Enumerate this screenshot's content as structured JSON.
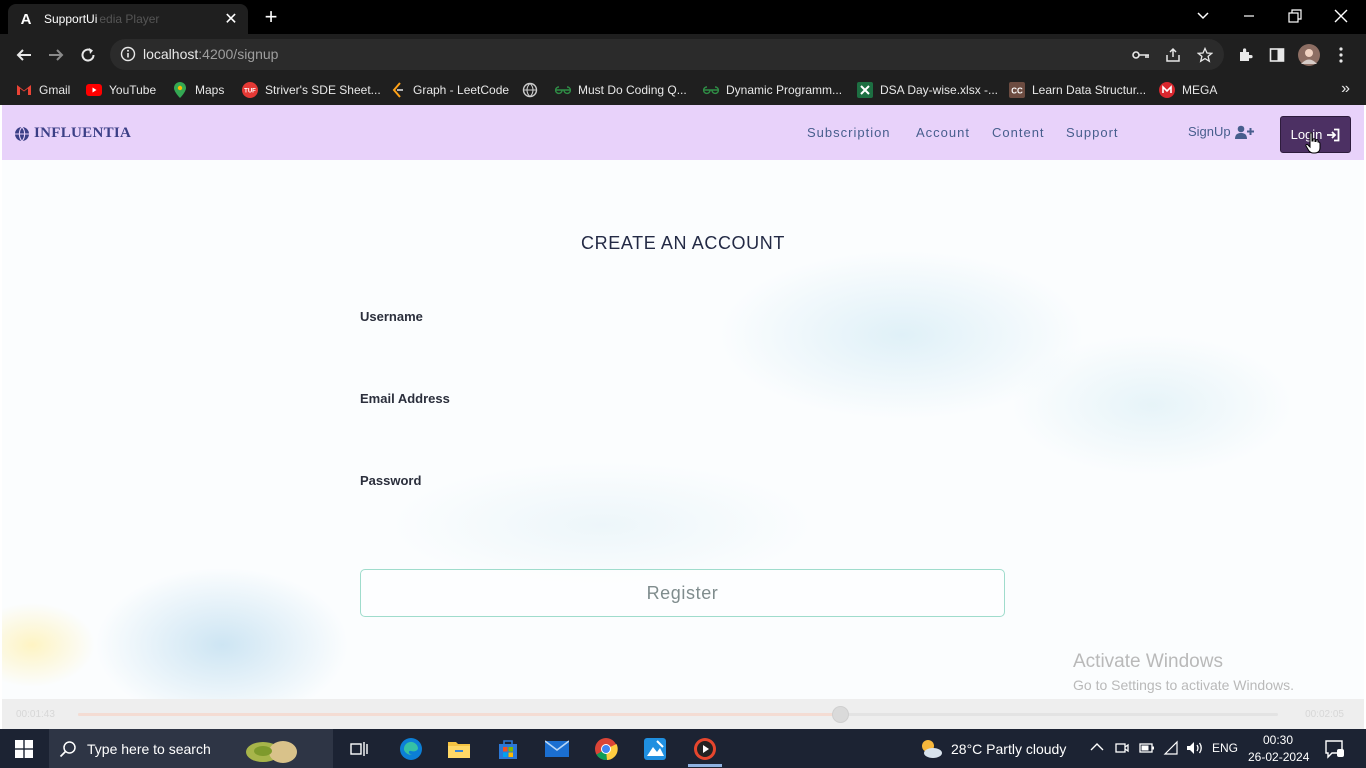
{
  "browser": {
    "tab": {
      "title": "SupportUi",
      "ghost_title": "edia Player",
      "favicon": "A"
    },
    "url": {
      "host": "localhost",
      "path": ":4200/signup"
    }
  },
  "bookmarks": [
    {
      "label": "Gmail",
      "icon": "gmail-icon",
      "color": "#ea4335"
    },
    {
      "label": "YouTube",
      "icon": "youtube-icon",
      "color": "#ff0000"
    },
    {
      "label": "Maps",
      "icon": "maps-icon",
      "color": "#34a853"
    },
    {
      "label": "Striver's SDE Sheet...",
      "icon": "tuf-icon",
      "color": "#e53935"
    },
    {
      "label": "Graph - LeetCode",
      "icon": "leetcode-icon",
      "color": "#ffa116"
    },
    {
      "label": "",
      "icon": "globe-icon",
      "color": "#cccccc"
    },
    {
      "label": "Must Do Coding Q...",
      "icon": "gfg-icon",
      "color": "#2f8d46"
    },
    {
      "label": "Dynamic Programm...",
      "icon": "gfg-icon",
      "color": "#2f8d46"
    },
    {
      "label": "DSA Day-wise.xlsx -...",
      "icon": "excel-icon",
      "color": "#1d6f42"
    },
    {
      "label": "Learn Data Structur...",
      "icon": "cc-icon",
      "color": "#6d4c41"
    },
    {
      "label": "MEGA",
      "icon": "mega-icon",
      "color": "#d9272e"
    }
  ],
  "app": {
    "brand": "INFLUENTIA",
    "nav": [
      "Subscription",
      "Account",
      "Content",
      "Support"
    ],
    "signup": "SignUp",
    "login": "Login",
    "form": {
      "title": "CREATE AN ACCOUNT",
      "username_label": "Username",
      "email_label": "Email Address",
      "password_label": "Password",
      "register": "Register"
    }
  },
  "watermark": {
    "title": "Activate Windows",
    "subtitle": "Go to Settings to activate Windows."
  },
  "player": {
    "elapsed": "00:01:43",
    "total": "00:02:05",
    "progress": 0.635
  },
  "taskbar": {
    "search_placeholder": "Type here to search",
    "weather": "28°C  Partly cloudy",
    "language": "ENG",
    "time": "00:30",
    "date": "26-02-2024"
  }
}
